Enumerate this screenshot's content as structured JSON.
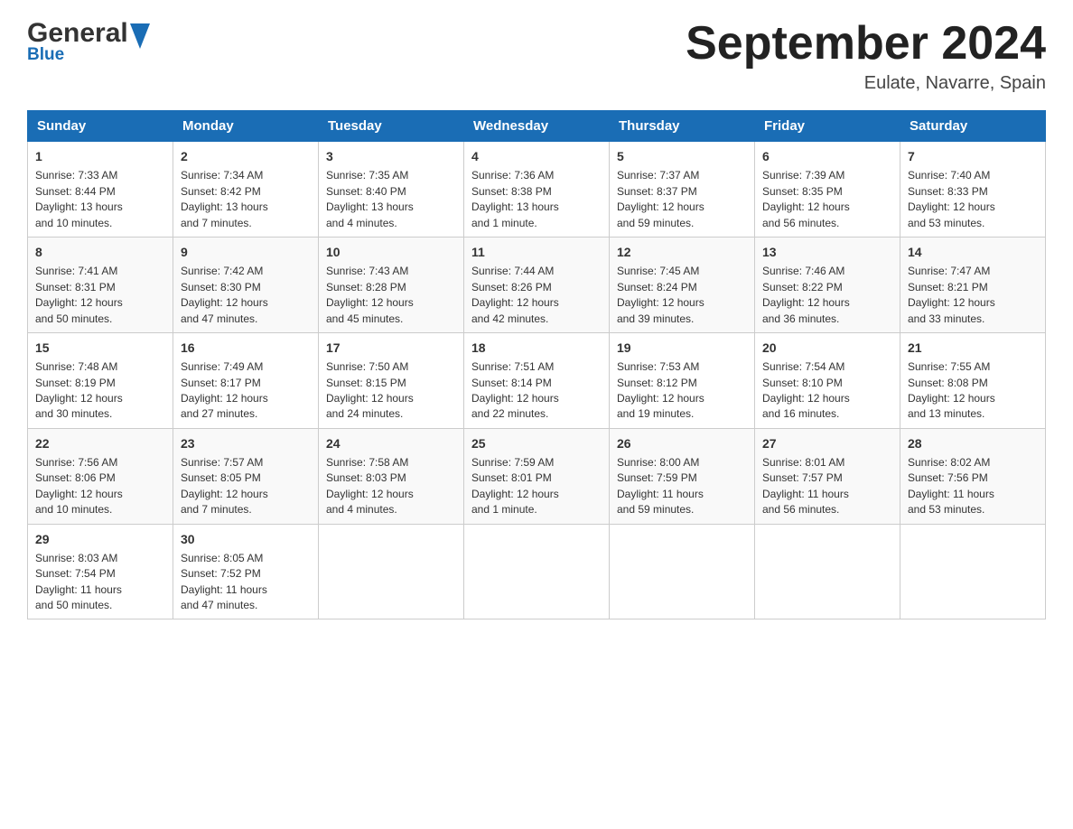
{
  "header": {
    "logo_general": "General",
    "logo_blue": "Blue",
    "month_title": "September 2024",
    "location": "Eulate, Navarre, Spain"
  },
  "days_of_week": [
    "Sunday",
    "Monday",
    "Tuesday",
    "Wednesday",
    "Thursday",
    "Friday",
    "Saturday"
  ],
  "weeks": [
    [
      {
        "day": "1",
        "sunrise": "7:33 AM",
        "sunset": "8:44 PM",
        "daylight": "13 hours and 10 minutes."
      },
      {
        "day": "2",
        "sunrise": "7:34 AM",
        "sunset": "8:42 PM",
        "daylight": "13 hours and 7 minutes."
      },
      {
        "day": "3",
        "sunrise": "7:35 AM",
        "sunset": "8:40 PM",
        "daylight": "13 hours and 4 minutes."
      },
      {
        "day": "4",
        "sunrise": "7:36 AM",
        "sunset": "8:38 PM",
        "daylight": "13 hours and 1 minute."
      },
      {
        "day": "5",
        "sunrise": "7:37 AM",
        "sunset": "8:37 PM",
        "daylight": "12 hours and 59 minutes."
      },
      {
        "day": "6",
        "sunrise": "7:39 AM",
        "sunset": "8:35 PM",
        "daylight": "12 hours and 56 minutes."
      },
      {
        "day": "7",
        "sunrise": "7:40 AM",
        "sunset": "8:33 PM",
        "daylight": "12 hours and 53 minutes."
      }
    ],
    [
      {
        "day": "8",
        "sunrise": "7:41 AM",
        "sunset": "8:31 PM",
        "daylight": "12 hours and 50 minutes."
      },
      {
        "day": "9",
        "sunrise": "7:42 AM",
        "sunset": "8:30 PM",
        "daylight": "12 hours and 47 minutes."
      },
      {
        "day": "10",
        "sunrise": "7:43 AM",
        "sunset": "8:28 PM",
        "daylight": "12 hours and 45 minutes."
      },
      {
        "day": "11",
        "sunrise": "7:44 AM",
        "sunset": "8:26 PM",
        "daylight": "12 hours and 42 minutes."
      },
      {
        "day": "12",
        "sunrise": "7:45 AM",
        "sunset": "8:24 PM",
        "daylight": "12 hours and 39 minutes."
      },
      {
        "day": "13",
        "sunrise": "7:46 AM",
        "sunset": "8:22 PM",
        "daylight": "12 hours and 36 minutes."
      },
      {
        "day": "14",
        "sunrise": "7:47 AM",
        "sunset": "8:21 PM",
        "daylight": "12 hours and 33 minutes."
      }
    ],
    [
      {
        "day": "15",
        "sunrise": "7:48 AM",
        "sunset": "8:19 PM",
        "daylight": "12 hours and 30 minutes."
      },
      {
        "day": "16",
        "sunrise": "7:49 AM",
        "sunset": "8:17 PM",
        "daylight": "12 hours and 27 minutes."
      },
      {
        "day": "17",
        "sunrise": "7:50 AM",
        "sunset": "8:15 PM",
        "daylight": "12 hours and 24 minutes."
      },
      {
        "day": "18",
        "sunrise": "7:51 AM",
        "sunset": "8:14 PM",
        "daylight": "12 hours and 22 minutes."
      },
      {
        "day": "19",
        "sunrise": "7:53 AM",
        "sunset": "8:12 PM",
        "daylight": "12 hours and 19 minutes."
      },
      {
        "day": "20",
        "sunrise": "7:54 AM",
        "sunset": "8:10 PM",
        "daylight": "12 hours and 16 minutes."
      },
      {
        "day": "21",
        "sunrise": "7:55 AM",
        "sunset": "8:08 PM",
        "daylight": "12 hours and 13 minutes."
      }
    ],
    [
      {
        "day": "22",
        "sunrise": "7:56 AM",
        "sunset": "8:06 PM",
        "daylight": "12 hours and 10 minutes."
      },
      {
        "day": "23",
        "sunrise": "7:57 AM",
        "sunset": "8:05 PM",
        "daylight": "12 hours and 7 minutes."
      },
      {
        "day": "24",
        "sunrise": "7:58 AM",
        "sunset": "8:03 PM",
        "daylight": "12 hours and 4 minutes."
      },
      {
        "day": "25",
        "sunrise": "7:59 AM",
        "sunset": "8:01 PM",
        "daylight": "12 hours and 1 minute."
      },
      {
        "day": "26",
        "sunrise": "8:00 AM",
        "sunset": "7:59 PM",
        "daylight": "11 hours and 59 minutes."
      },
      {
        "day": "27",
        "sunrise": "8:01 AM",
        "sunset": "7:57 PM",
        "daylight": "11 hours and 56 minutes."
      },
      {
        "day": "28",
        "sunrise": "8:02 AM",
        "sunset": "7:56 PM",
        "daylight": "11 hours and 53 minutes."
      }
    ],
    [
      {
        "day": "29",
        "sunrise": "8:03 AM",
        "sunset": "7:54 PM",
        "daylight": "11 hours and 50 minutes."
      },
      {
        "day": "30",
        "sunrise": "8:05 AM",
        "sunset": "7:52 PM",
        "daylight": "11 hours and 47 minutes."
      },
      null,
      null,
      null,
      null,
      null
    ]
  ],
  "labels": {
    "sunrise": "Sunrise:",
    "sunset": "Sunset:",
    "daylight": "Daylight:"
  }
}
